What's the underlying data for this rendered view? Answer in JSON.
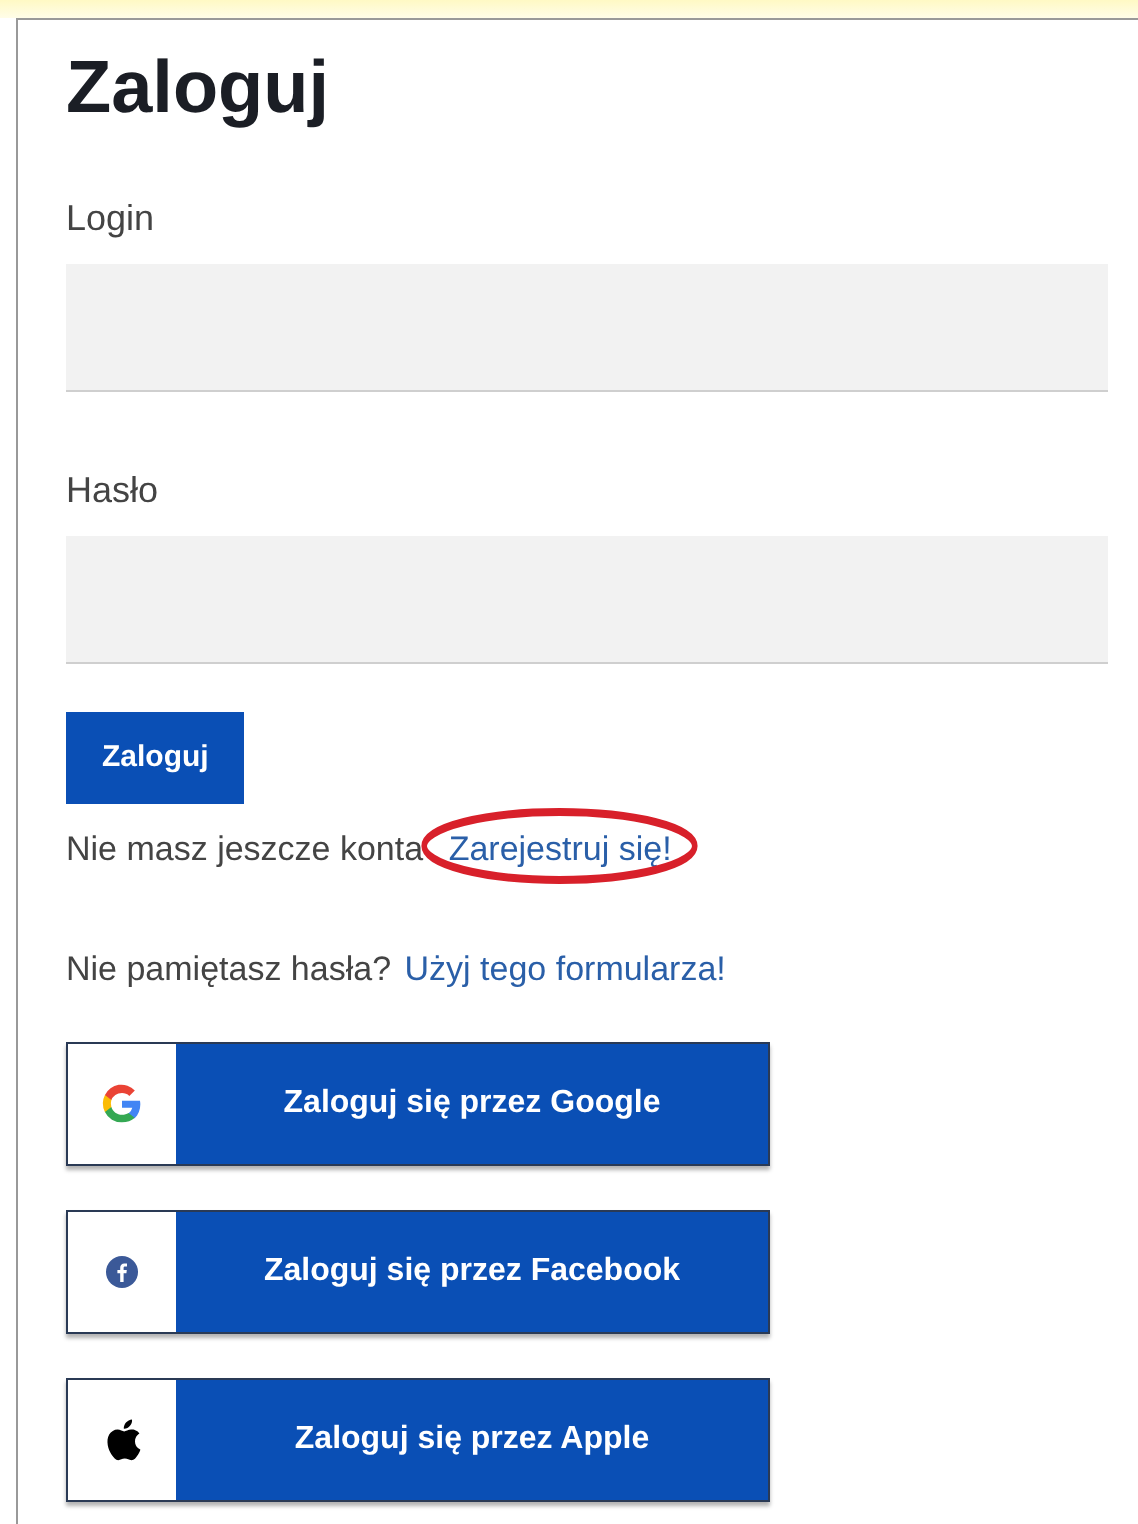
{
  "title": "Zaloguj",
  "fields": [
    {
      "label": "Login"
    },
    {
      "label": "Hasło"
    }
  ],
  "submit_button": "Zaloguj",
  "register_prompt": {
    "text": "Nie masz jeszcze konta",
    "link": "Zarejestruj się!",
    "highlighted": true
  },
  "reset_prompt": {
    "text": "Nie pamiętasz hasła?",
    "link": "Użyj tego formularza!"
  },
  "social_buttons": [
    {
      "kind": "google",
      "label": "Zaloguj się przez Google"
    },
    {
      "kind": "facebook",
      "label": "Zaloguj się przez Facebook"
    },
    {
      "kind": "apple",
      "label": "Zaloguj się przez Apple"
    }
  ]
}
